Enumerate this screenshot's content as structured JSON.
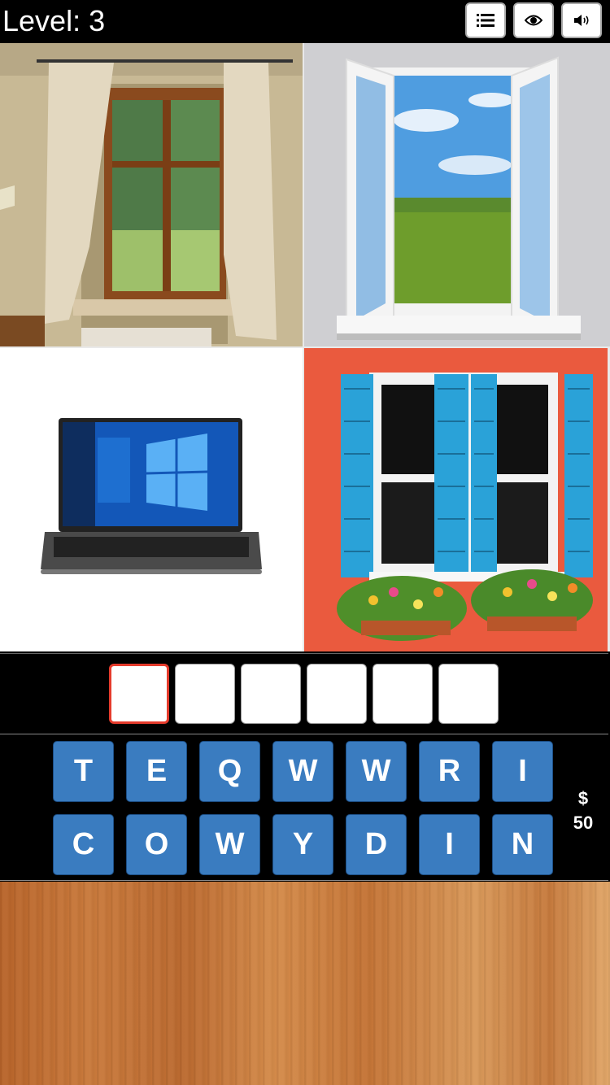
{
  "header": {
    "level_text": "Level: 3",
    "buttons": [
      {
        "icon": "list-icon"
      },
      {
        "icon": "eye-icon"
      },
      {
        "icon": "speaker-icon"
      }
    ]
  },
  "pictures": [
    {
      "subject": "window-with-curtains"
    },
    {
      "subject": "open-white-window-field"
    },
    {
      "subject": "laptop-with-windows-os"
    },
    {
      "subject": "blue-shutters-window-flowers"
    }
  ],
  "answer": {
    "slot_count": 6,
    "active_slot": 0,
    "letters": [
      "",
      "",
      "",
      "",
      "",
      ""
    ]
  },
  "keyboard": {
    "rows": [
      [
        "T",
        "E",
        "Q",
        "W",
        "W",
        "R",
        "I"
      ],
      [
        "C",
        "O",
        "W",
        "Y",
        "D",
        "I",
        "N"
      ]
    ]
  },
  "coins": {
    "symbol": "$",
    "amount": "50"
  },
  "colors": {
    "key_blue": "#3a7cc0",
    "active_slot_border": "#e53b2c"
  }
}
